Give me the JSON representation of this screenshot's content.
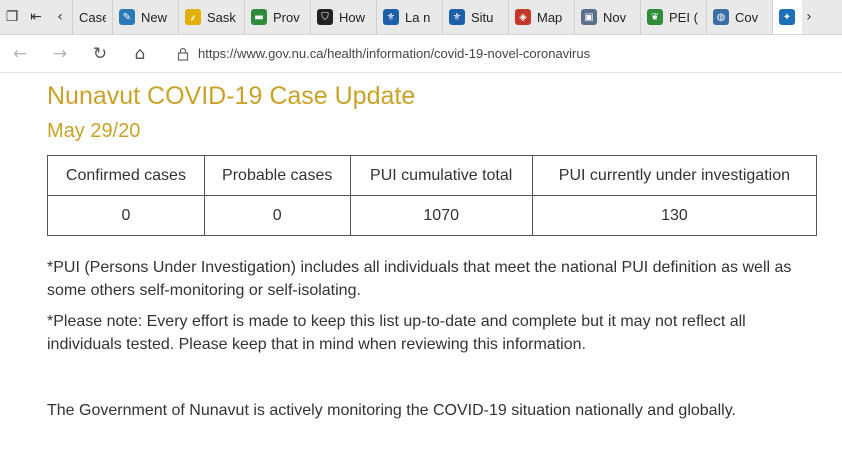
{
  "browser": {
    "tabs": [
      {
        "label": "Case",
        "icon": "page-icon",
        "color": "#e9e9e9"
      },
      {
        "label": "New",
        "icon": "news-icon",
        "color": "#2a7ab8"
      },
      {
        "label": "Sask",
        "icon": "wheat-icon",
        "color": "#e0b000"
      },
      {
        "label": "Prov",
        "icon": "flag-icon",
        "color": "#2e8b3a"
      },
      {
        "label": "How",
        "icon": "shield-icon",
        "color": "#222222"
      },
      {
        "label": "La n",
        "icon": "fleur-de-lis-icon",
        "color": "#1d5fa8"
      },
      {
        "label": "Situ",
        "icon": "fleur-de-lis-icon",
        "color": "#1d5fa8"
      },
      {
        "label": "Map",
        "icon": "map-icon",
        "color": "#c0392b"
      },
      {
        "label": "Nov",
        "icon": "image-icon",
        "color": "#5b6e8a"
      },
      {
        "label": "PEI (",
        "icon": "leaf-icon",
        "color": "#2e8b3a"
      },
      {
        "label": "Cov",
        "icon": "globe-icon",
        "color": "#3a6ea5"
      }
    ],
    "url": "https://www.gov.nu.ca/health/information/covid-19-novel-coronavirus"
  },
  "page": {
    "title": "Nunavut COVID-19 Case Update",
    "date": "May 29/20",
    "table": {
      "headers": [
        "Confirmed cases",
        "Probable cases",
        "PUI cumulative total",
        "PUI currently under investigation"
      ],
      "rows": [
        [
          "0",
          "0",
          "1070",
          "130"
        ]
      ]
    },
    "note1": "*PUI (Persons Under Investigation) includes all individuals that meet the national PUI definition as well as some others self-monitoring or self-isolating.",
    "note2": "*Please note: Every effort is made to keep this list up-to-date and complete but it may not reflect all individuals tested. Please keep that in mind when reviewing this information.",
    "note3": "The Government of Nunavut is actively monitoring the COVID-19 situation nationally and globally."
  },
  "colors": {
    "accent": "#c9a227",
    "text": "#333333"
  }
}
